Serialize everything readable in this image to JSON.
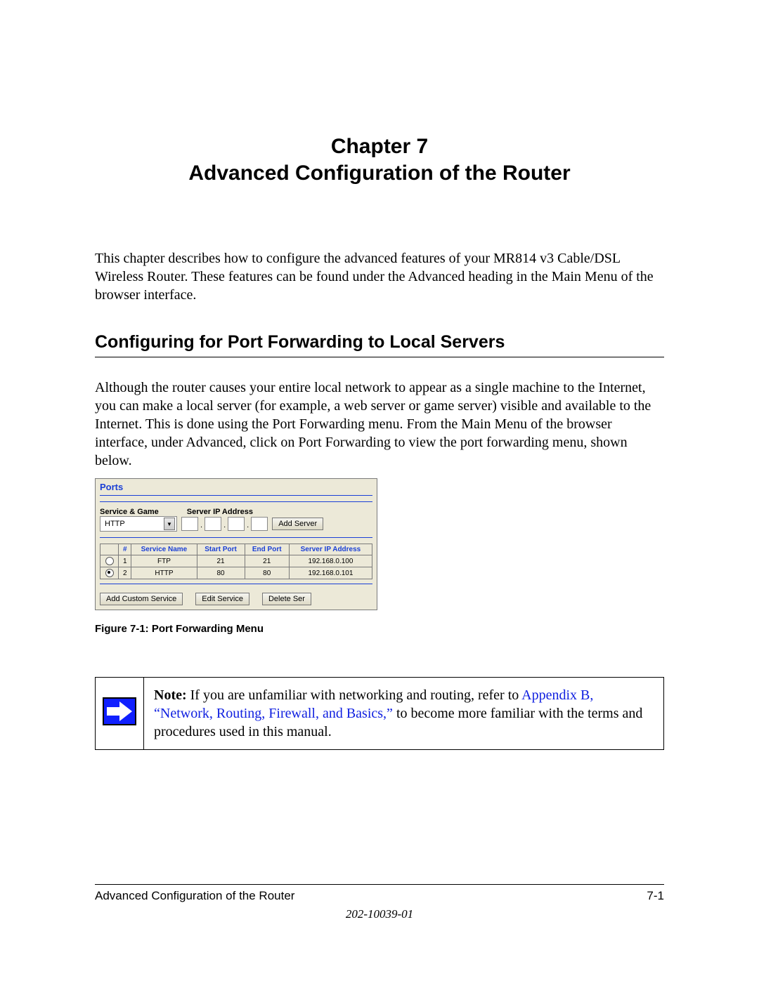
{
  "chapter": {
    "line1": "Chapter 7",
    "line2": "Advanced Configuration of the Router"
  },
  "intro": "This chapter describes how to configure the advanced features of your MR814 v3 Cable/DSL Wireless Router. These features can be found under the Advanced heading in the Main Menu of the browser interface.",
  "section_heading": "Configuring for Port Forwarding to Local Servers",
  "section_body": "Although the router causes your entire local network to appear as a single machine to the Internet, you can make a local server (for example, a web server or game server) visible and available to the Internet. This is done using the Port Forwarding menu. From the Main Menu of the browser interface, under Advanced, click on Port Forwarding to view the port forwarding menu, shown below.",
  "ui": {
    "panel_title": "Ports",
    "label_service_game": "Service & Game",
    "label_server_ip": "Server IP Address",
    "select_value": "HTTP",
    "add_server_btn": "Add Server",
    "table": {
      "headers": [
        "",
        "#",
        "Service Name",
        "Start Port",
        "End Port",
        "Server IP Address"
      ],
      "rows": [
        {
          "selected": false,
          "num": "1",
          "service": "FTP",
          "start": "21",
          "end": "21",
          "ip": "192.168.0.100"
        },
        {
          "selected": true,
          "num": "2",
          "service": "HTTP",
          "start": "80",
          "end": "80",
          "ip": "192.168.0.101"
        }
      ]
    },
    "btn_add_custom": "Add Custom Service",
    "btn_edit": "Edit Service",
    "btn_delete": "Delete Ser"
  },
  "figure_caption": "Figure 7-1:  Port Forwarding Menu",
  "note": {
    "bold": "Note:",
    "text1": " If you are unfamiliar with networking and routing, refer to ",
    "link": "Appendix B, “Network, Routing, Firewall, and Basics,”",
    "text2": " to become more familiar with the terms and procedures used in this manual."
  },
  "footer": {
    "left": "Advanced Configuration of the Router",
    "right": "7-1",
    "docnum": "202-10039-01"
  }
}
